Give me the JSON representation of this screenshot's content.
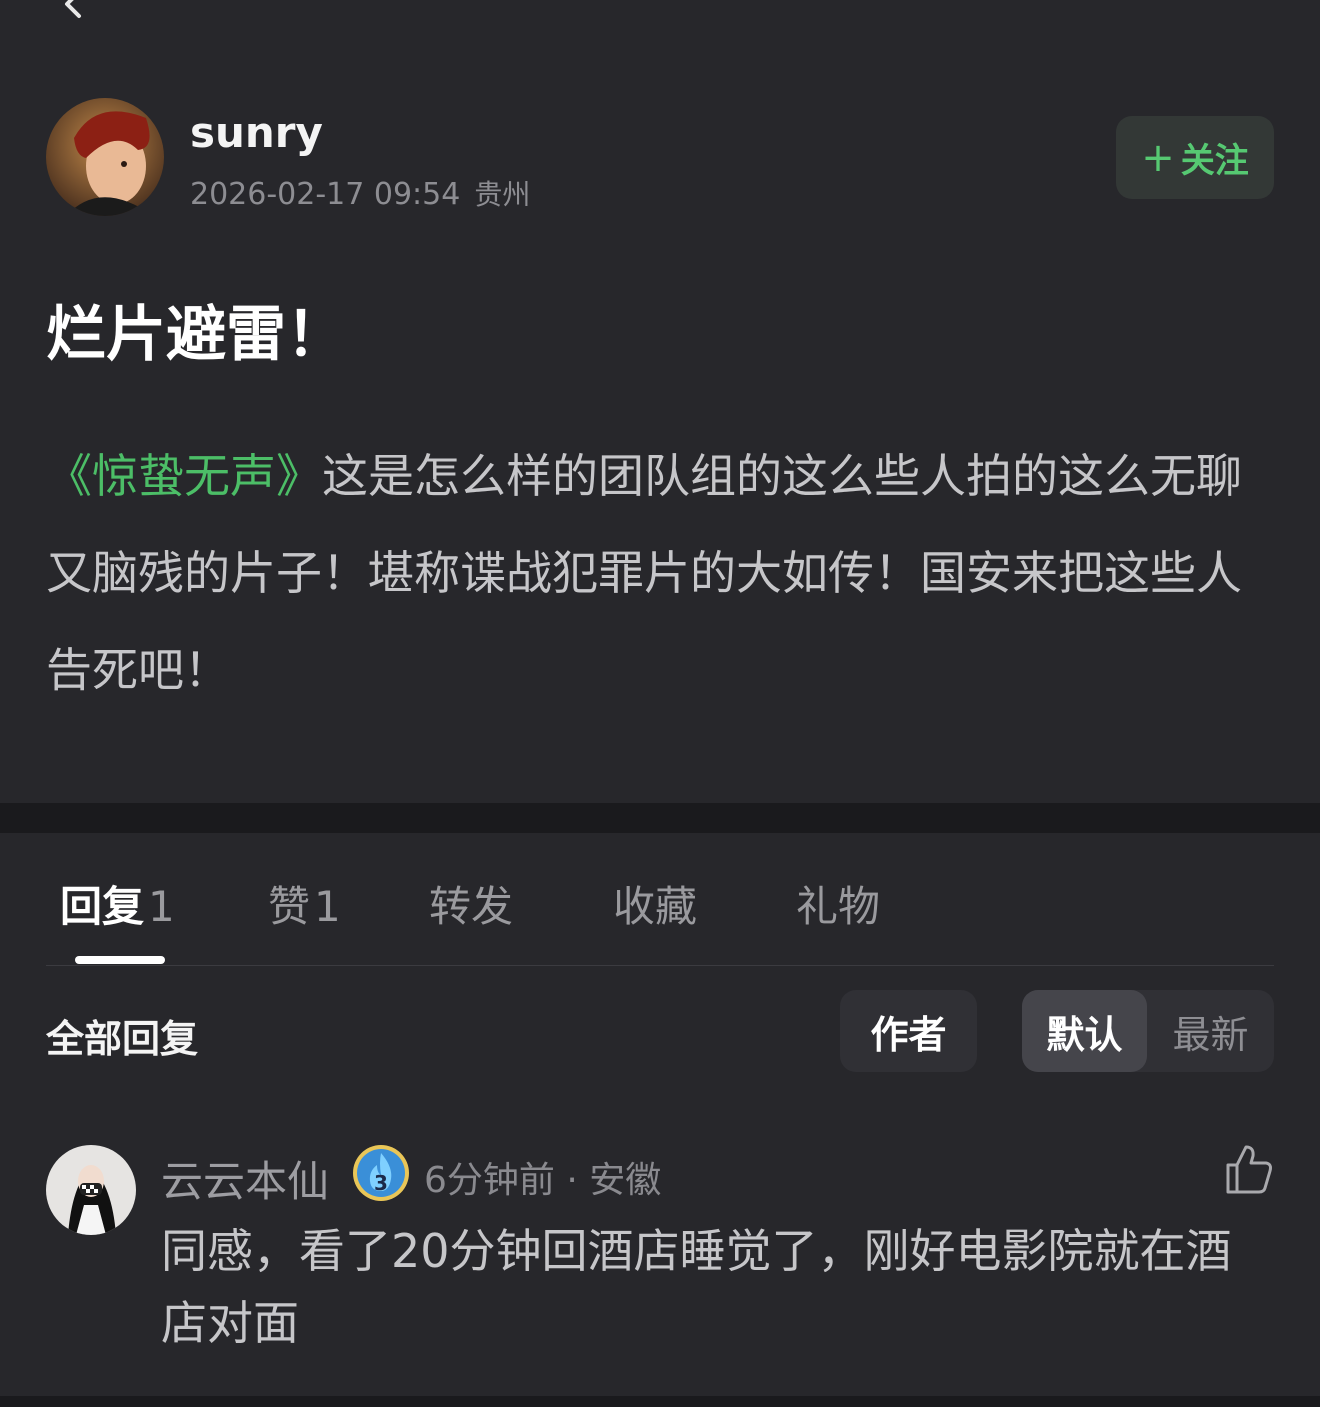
{
  "post": {
    "username": "sunry",
    "datetime": "2026-02-17 09:54",
    "location": "贵州",
    "follow_label": "关注",
    "follow_plus": "+",
    "title": "烂片避雷！",
    "movie_link": "《惊蛰无声》",
    "body": "这是怎么样的团队组的这么些人拍的这么无聊又脑残的片子！堪称谍战犯罪片的大如传！国安来把这些人告死吧！"
  },
  "tabs": {
    "reply_label": "回复",
    "reply_count": "1",
    "like_label": "赞",
    "like_count": "1",
    "repost_label": "转发",
    "favorite_label": "收藏",
    "gift_label": "礼物"
  },
  "filters": {
    "all_replies": "全部回复",
    "author": "作者",
    "default": "默认",
    "latest": "最新"
  },
  "comment": {
    "name": "云云本仙",
    "badge_level": "3",
    "meta": "6分钟前 · 安徽",
    "text": "同感，看了20分钟回酒店睡觉了，刚好电影院就在酒店对面"
  },
  "colors": {
    "background": "#27272b",
    "accent_green": "#4cbe67",
    "divider": "#1a1a1d"
  },
  "icons": {
    "back": "back-icon",
    "like": "thumbs-up-icon",
    "badge": "flame-level-badge-icon"
  }
}
